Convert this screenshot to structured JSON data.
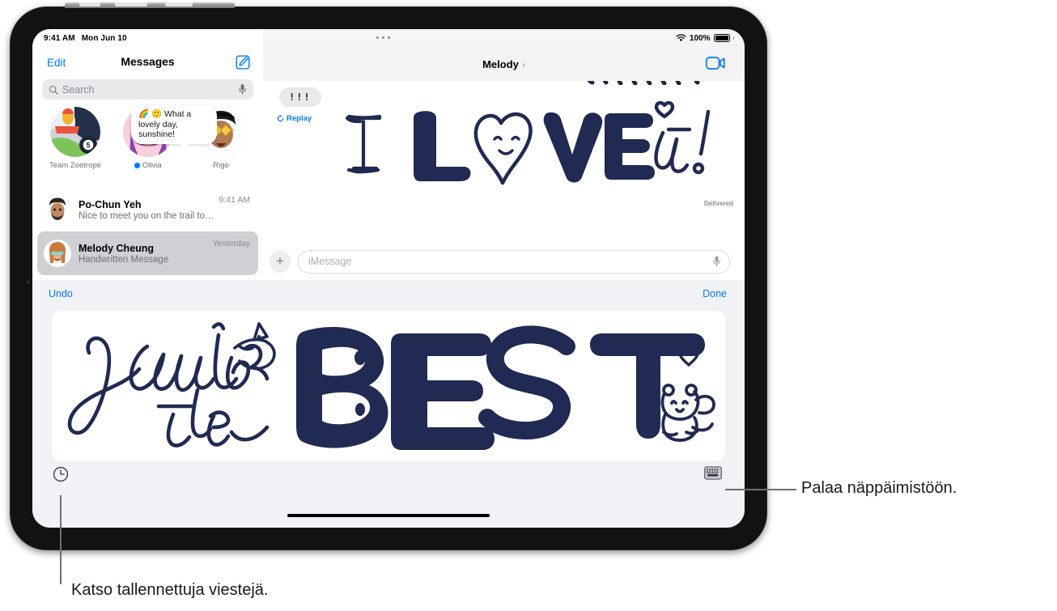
{
  "statusbar": {
    "time": "9:41 AM",
    "date": "Mon Jun 10",
    "battery_percent": "100%"
  },
  "sidebar": {
    "edit_label": "Edit",
    "title": "Messages",
    "compose_icon": "compose-icon",
    "search": {
      "placeholder": "Search",
      "icon": "search-icon",
      "dictation_icon": "microphone-icon"
    },
    "pinned": [
      {
        "name": "Team Zoetrope",
        "badge": "5",
        "has_unread_dot": false
      },
      {
        "name": "Olivia",
        "has_unread_dot": true,
        "tooltip": "🌈 🙂 What a lovely day, sunshine!"
      },
      {
        "name": "Rigo",
        "has_unread_dot": false
      }
    ],
    "conversations": [
      {
        "name": "Po-Chun Yeh",
        "preview": "Nice to meet you on the trail today",
        "time": "9:41 AM",
        "selected": false
      },
      {
        "name": "Melody Cheung",
        "preview": "Handwritten Message",
        "time": "Yesterday",
        "selected": true
      }
    ]
  },
  "conversation": {
    "title": "Melody",
    "detail_chevron": "›",
    "facetime_icon": "video-camera-icon",
    "messages": [
      {
        "type": "text-effect-bubble",
        "text": "!!!",
        "replay_label": "Replay",
        "replay_icon": "replay-arrow-icon"
      },
      {
        "type": "handwritten",
        "text": "I LOVE it!",
        "status": "Delivered"
      }
    ],
    "composer": {
      "add_icon": "plus-icon",
      "placeholder": "iMessage",
      "value": "",
      "dictation_icon": "microphone-icon"
    }
  },
  "handwriting_panel": {
    "undo_label": "Undo",
    "done_label": "Done",
    "canvas_text": "You're the BEST",
    "recents_icon": "clock-icon",
    "keyboard_icon": "keyboard-icon"
  },
  "callouts": [
    {
      "text": "Palaa näppäimistöön.",
      "target": "keyboard-icon"
    },
    {
      "text": "Katso tallennettuja viestejä.",
      "target": "clock-icon"
    }
  ],
  "colors": {
    "accent_blue": "#007aff",
    "ink_navy": "#202a52",
    "panel_gray": "#f1f2f6",
    "selected_row": "#cfcfd4"
  }
}
